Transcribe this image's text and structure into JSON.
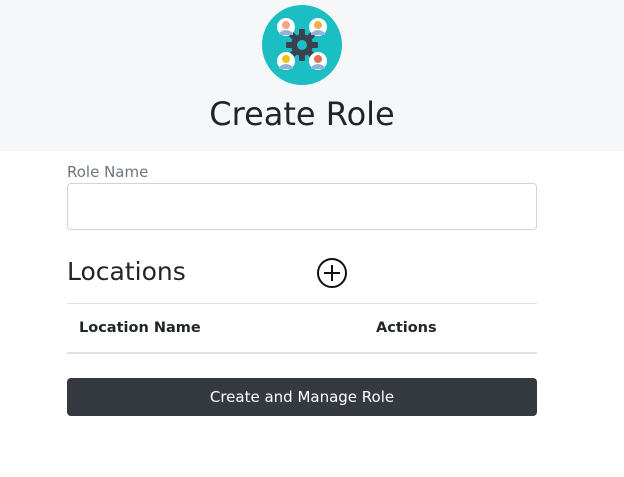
{
  "header": {
    "logo_icon": "team-settings-icon",
    "title": "Create Role"
  },
  "form": {
    "role_name_label": "Role Name",
    "role_name_value": "",
    "role_name_placeholder": ""
  },
  "locations": {
    "title": "Locations",
    "add_icon": "plus-circle-icon",
    "columns": [
      "Location Name",
      "Actions"
    ],
    "rows": []
  },
  "submit_label": "Create and Manage Role",
  "colors": {
    "header_bg": "#f6f7f8",
    "logo_bg": "#1bbfc3",
    "button_bg": "#343a40",
    "button_text": "#ffffff"
  }
}
